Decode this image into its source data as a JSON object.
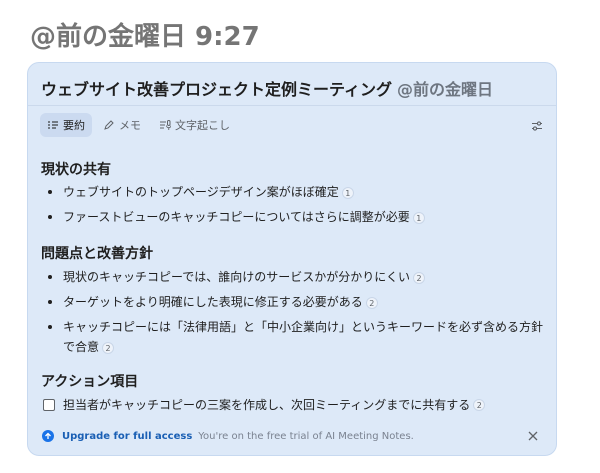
{
  "page_heading": "@前の金曜日 9:27",
  "card": {
    "title": "ウェブサイト改善プロジェクト定例ミーティング",
    "title_meta": "@前の金曜日",
    "tabs": [
      {
        "label": "要約",
        "icon": "summary-list-icon",
        "active": true
      },
      {
        "label": "メモ",
        "icon": "pencil-icon",
        "active": false
      },
      {
        "label": "文字起こし",
        "icon": "transcript-icon",
        "active": false
      }
    ],
    "sections": [
      {
        "title": "現状の共有",
        "bullets": [
          {
            "text": "ウェブサイトのトップページデザイン案がほぼ確定",
            "cite": "1"
          },
          {
            "text": "ファーストビューのキャッチコピーについてはさらに調整が必要",
            "cite": "1"
          }
        ]
      },
      {
        "title": "問題点と改善方針",
        "bullets": [
          {
            "text": "現状のキャッチコピーでは、誰向けのサービスかが分かりにくい",
            "cite": "2"
          },
          {
            "text": "ターゲットをより明確にした表現に修正する必要がある",
            "cite": "2"
          },
          {
            "text": "キャッチコピーには「法律用語」と「中小企業向け」というキーワードを必ず含める方針で合意",
            "cite": "2"
          }
        ]
      },
      {
        "title": "アクション項目",
        "action": {
          "text": "担当者がキャッチコピーの三案を作成し、次回ミーティングまでに共有する",
          "cite": "2",
          "checked": false
        }
      }
    ],
    "footer": {
      "link": "Upgrade for full access",
      "note": "You're on the free trial of AI Meeting Notes."
    }
  },
  "colors": {
    "card_bg": "#dde9f8",
    "accent": "#1a73e8",
    "heading": "#757575"
  }
}
